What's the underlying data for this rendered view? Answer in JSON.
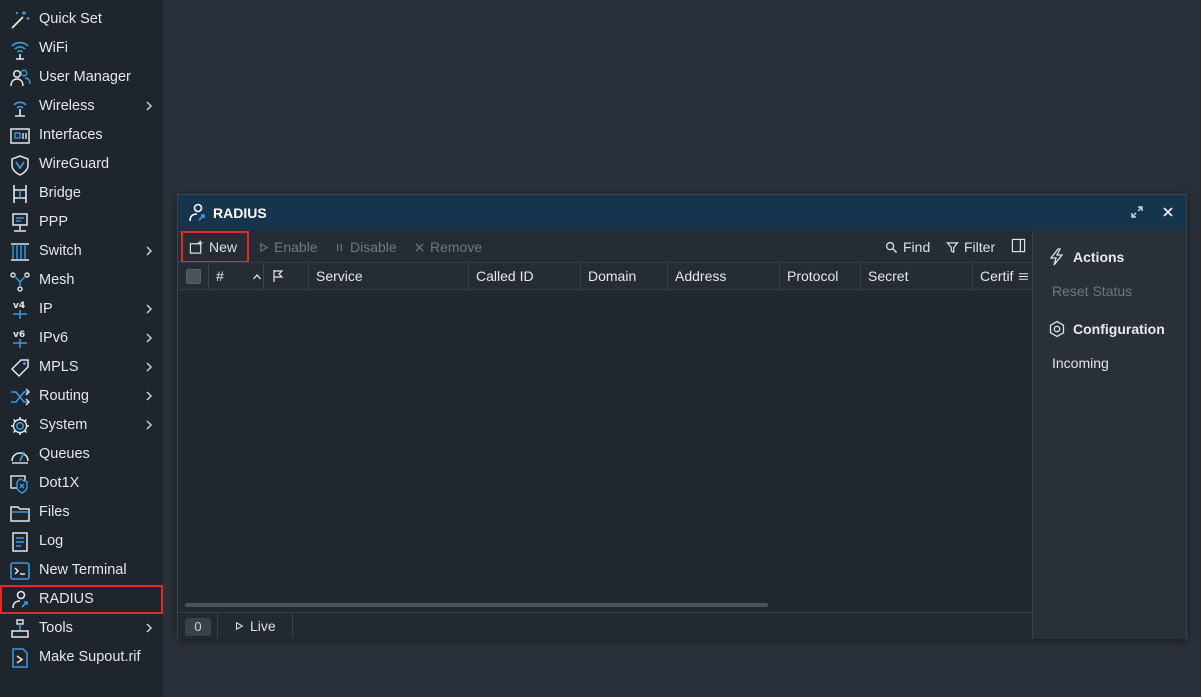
{
  "colors": {
    "accent": "#3b9ae1",
    "highlight_box": "#e02b2b",
    "window_title_bg": "#17344f",
    "sidebar_bg": "#1f252c",
    "desktop_bg": "#2b313a"
  },
  "sidebar": {
    "items": [
      {
        "label": "Quick Set",
        "icon": "magic-wand-icon",
        "chevron": false
      },
      {
        "label": "WiFi",
        "icon": "wifi-icon",
        "chevron": false
      },
      {
        "label": "User Manager",
        "icon": "users-icon",
        "chevron": false
      },
      {
        "label": "Wireless",
        "icon": "wireless-icon",
        "chevron": true
      },
      {
        "label": "Interfaces",
        "icon": "interfaces-icon",
        "chevron": false
      },
      {
        "label": "WireGuard",
        "icon": "shield-icon",
        "chevron": false
      },
      {
        "label": "Bridge",
        "icon": "bridge-icon",
        "chevron": false
      },
      {
        "label": "PPP",
        "icon": "ppp-icon",
        "chevron": false
      },
      {
        "label": "Switch",
        "icon": "switch-icon",
        "chevron": true
      },
      {
        "label": "Mesh",
        "icon": "mesh-icon",
        "chevron": false
      },
      {
        "label": "IP",
        "icon": "ipv4-icon",
        "chevron": true
      },
      {
        "label": "IPv6",
        "icon": "ipv6-icon",
        "chevron": true
      },
      {
        "label": "MPLS",
        "icon": "tag-icon",
        "chevron": true
      },
      {
        "label": "Routing",
        "icon": "routing-icon",
        "chevron": true
      },
      {
        "label": "System",
        "icon": "gear-icon",
        "chevron": true
      },
      {
        "label": "Queues",
        "icon": "gauge-icon",
        "chevron": false
      },
      {
        "label": "Dot1X",
        "icon": "dot1x-icon",
        "chevron": false
      },
      {
        "label": "Files",
        "icon": "folder-icon",
        "chevron": false
      },
      {
        "label": "Log",
        "icon": "log-icon",
        "chevron": false
      },
      {
        "label": "New Terminal",
        "icon": "terminal-icon",
        "chevron": false
      },
      {
        "label": "RADIUS",
        "icon": "radius-icon",
        "chevron": false,
        "selected": true
      },
      {
        "label": "Tools",
        "icon": "tools-icon",
        "chevron": true
      },
      {
        "label": "Make Supout.rif",
        "icon": "supout-icon",
        "chevron": false
      }
    ]
  },
  "window": {
    "title": "RADIUS",
    "toolbar": {
      "new": "New",
      "enable": "Enable",
      "disable": "Disable",
      "remove": "Remove",
      "find": "Find",
      "filter": "Filter"
    },
    "columns": [
      "#",
      "Service",
      "Called ID",
      "Domain",
      "Address",
      "Protocol",
      "Secret",
      "Certif"
    ],
    "rows": [],
    "status": {
      "count": "0",
      "live": "Live"
    },
    "side_panel": {
      "actions_title": "Actions",
      "reset_status": "Reset Status",
      "configuration_title": "Configuration",
      "incoming": "Incoming"
    }
  }
}
